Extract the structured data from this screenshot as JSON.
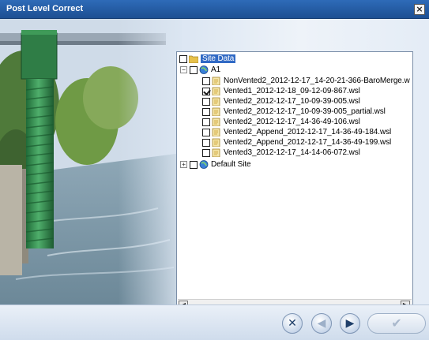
{
  "window": {
    "title": "Post Level Correct",
    "close_glyph": "×"
  },
  "tree": {
    "root": {
      "label": "Site Data",
      "icon": "folder-icon"
    },
    "sites": [
      {
        "label": "A1",
        "expander": "−",
        "icon": "globe-icon",
        "files": [
          {
            "label": "NonVented2_2012-12-17_14-20-21-366-BaroMerge.w",
            "checked": false
          },
          {
            "label": "Vented1_2012-12-18_09-12-09-867.wsl",
            "checked": true
          },
          {
            "label": "Vented2_2012-12-17_10-09-39-005.wsl",
            "checked": false
          },
          {
            "label": "Vented2_2012-12-17_10-09-39-005_partial.wsl",
            "checked": false
          },
          {
            "label": "Vented2_2012-12-17_14-36-49-106.wsl",
            "checked": false
          },
          {
            "label": "Vented2_Append_2012-12-17_14-36-49-184.wsl",
            "checked": false
          },
          {
            "label": "Vented2_Append_2012-12-17_14-36-49-199.wsl",
            "checked": false
          },
          {
            "label": "Vented3_2012-12-17_14-14-06-072.wsl",
            "checked": false
          }
        ]
      },
      {
        "label": "Default Site",
        "expander": "+",
        "icon": "globe-icon",
        "files": []
      }
    ]
  },
  "scrollbar": {
    "left_glyph": "◀",
    "right_glyph": "▶"
  },
  "footer": {
    "cancel_glyph": "✕",
    "back_glyph": "◀",
    "next_glyph": "▶",
    "ok_glyph": "✔"
  },
  "colors": {
    "titlebar": "#2e6bb8",
    "selection": "#316ac5",
    "pipe_green": "#2f8a4c",
    "water": "#7d97a8"
  }
}
